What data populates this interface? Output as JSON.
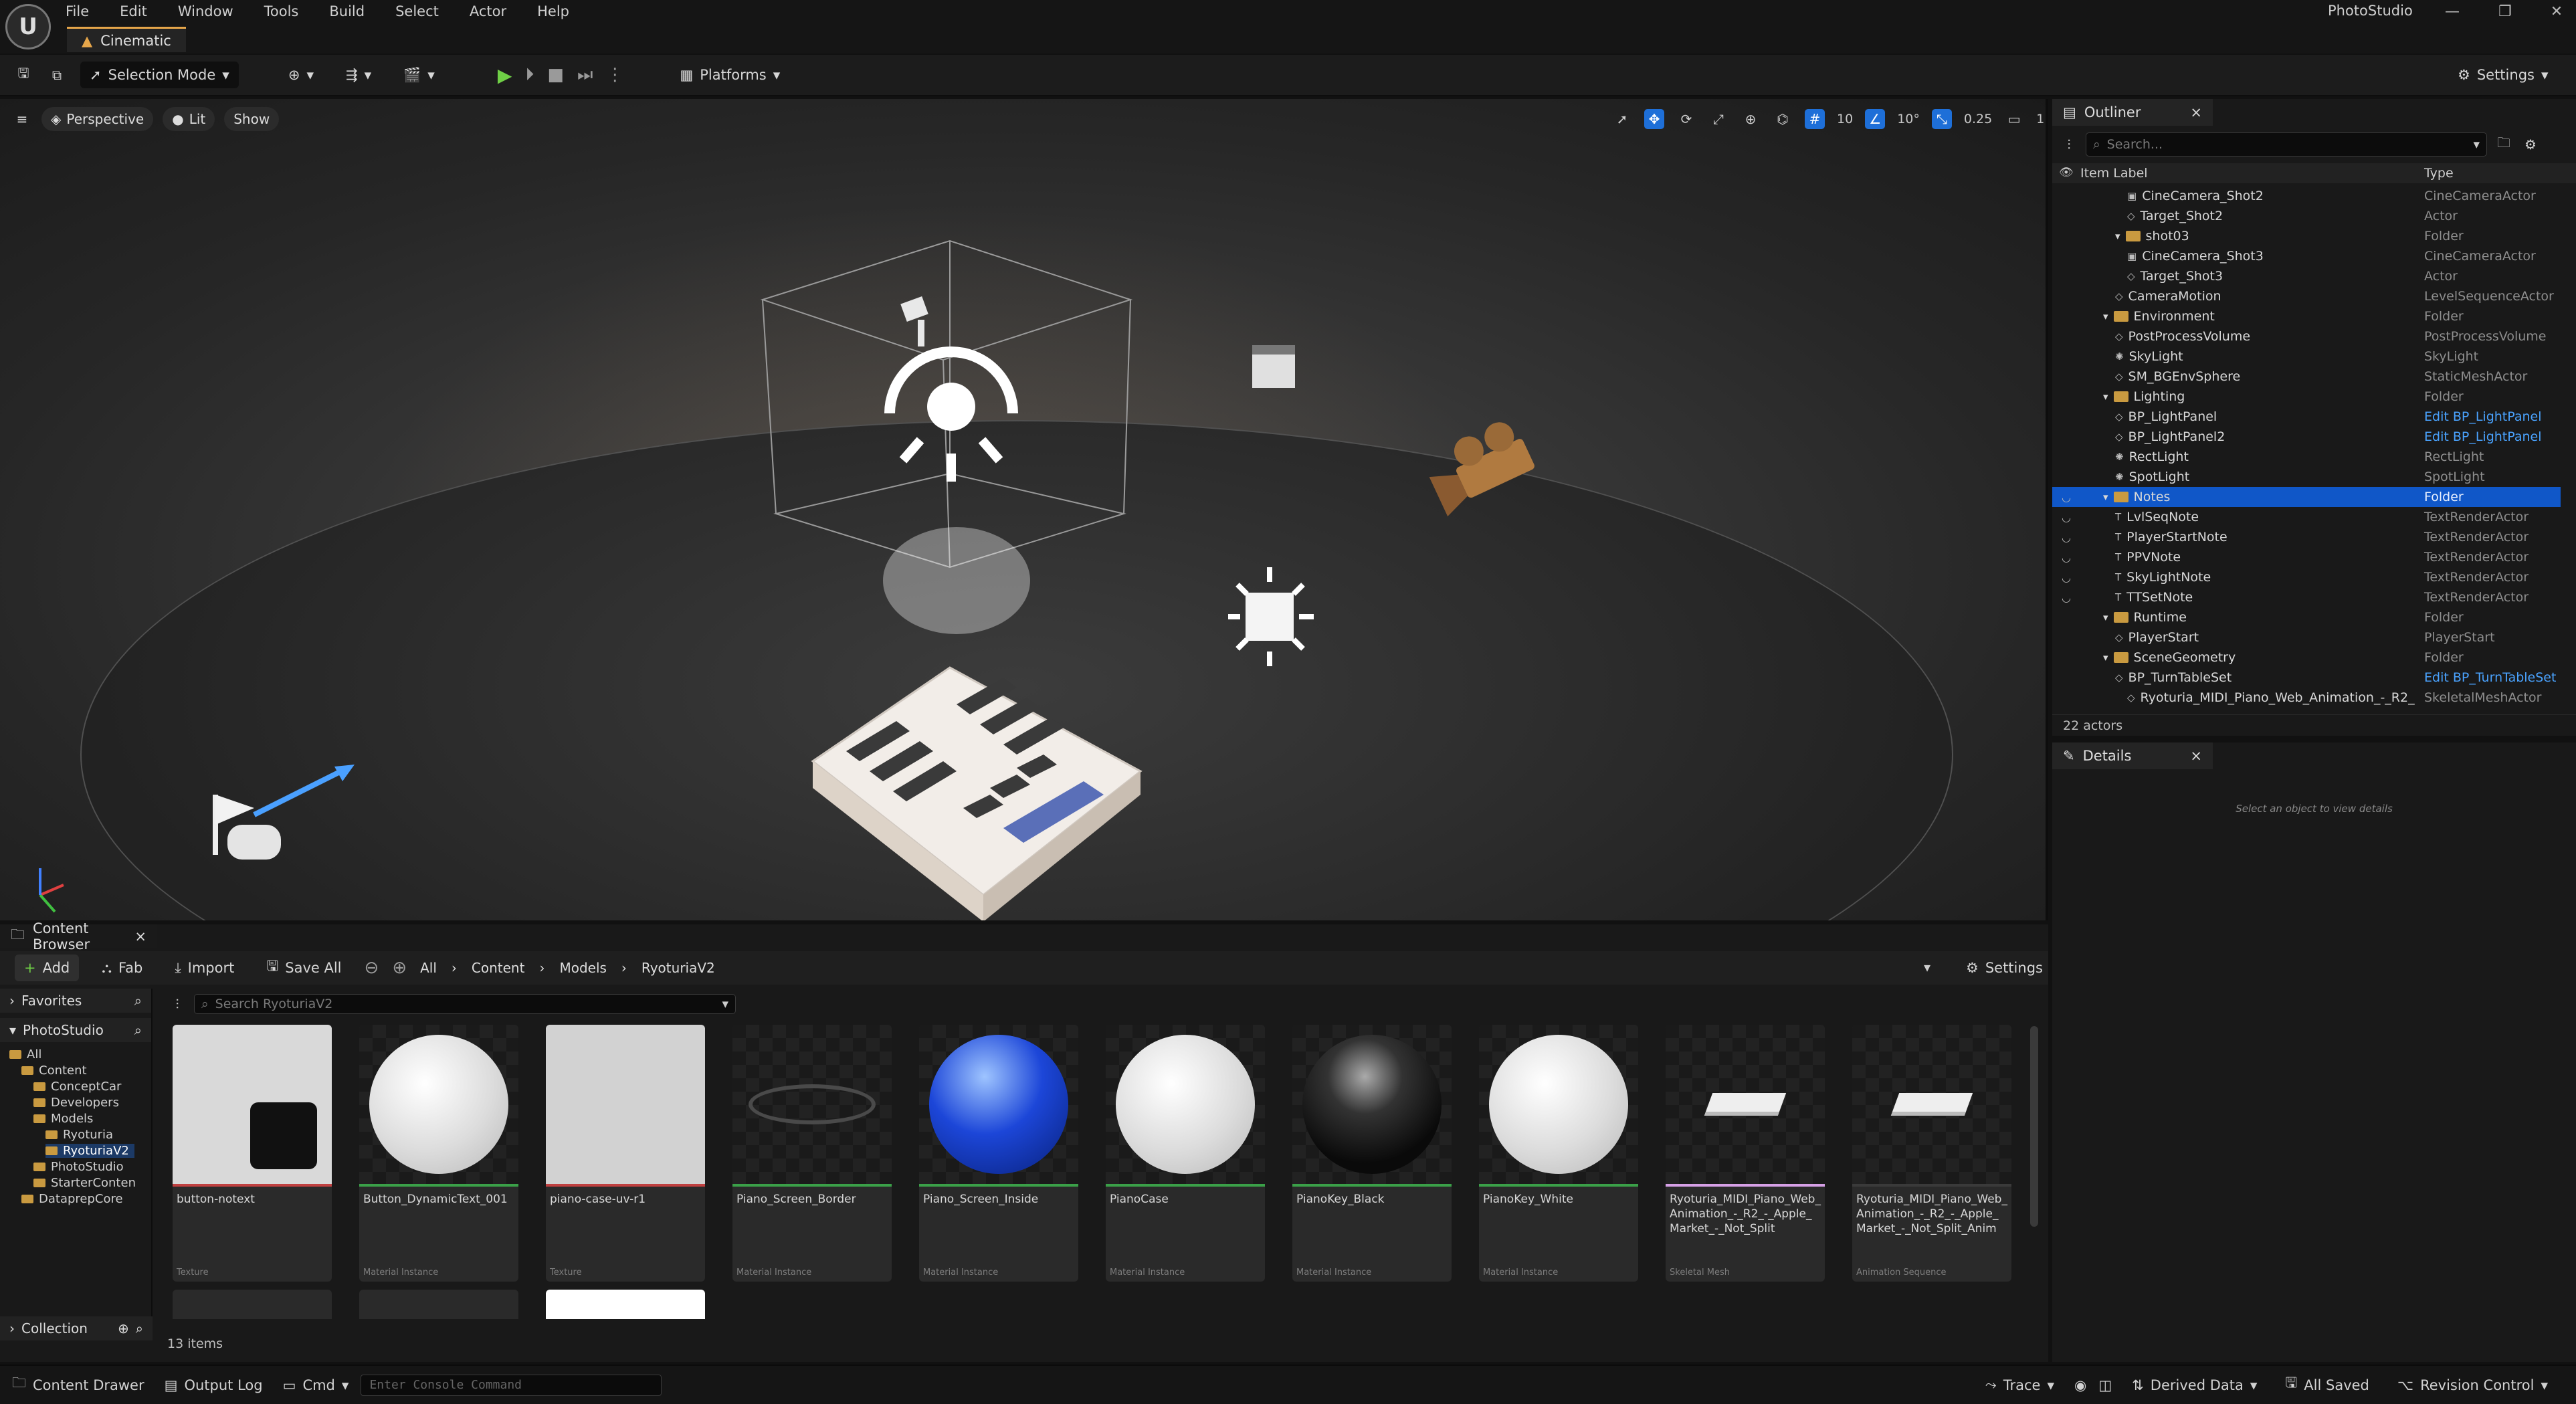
{
  "menubar": {
    "logo": "U",
    "menus": [
      "File",
      "Edit",
      "Window",
      "Tools",
      "Build",
      "Select",
      "Actor",
      "Help"
    ],
    "tab": "Cinematic",
    "app_title": "PhotoStudio",
    "win_controls": [
      "—",
      "❐",
      "✕"
    ]
  },
  "toolbar": {
    "selection_mode": "Selection Mode",
    "platforms": "Platforms",
    "settings": "Settings"
  },
  "viewport": {
    "perspective": "Perspective",
    "lit": "Lit",
    "show": "Show",
    "grid_snap": "10",
    "rot_snap": "10°",
    "scale_snap": "0.25",
    "camera_speed": "1"
  },
  "outliner": {
    "tab": "Outliner",
    "search_placeholder": "Search...",
    "col_label": "Item Label",
    "col_type": "Type",
    "rows": [
      {
        "label": "CineCamera_Shot2",
        "type": "CineCameraActor",
        "indent": 4,
        "kind": "camera"
      },
      {
        "label": "Target_Shot2",
        "type": "Actor",
        "indent": 4,
        "kind": "actor"
      },
      {
        "label": "shot03",
        "type": "Folder",
        "indent": 3,
        "kind": "folder"
      },
      {
        "label": "CineCamera_Shot3",
        "type": "CineCameraActor",
        "indent": 4,
        "kind": "camera"
      },
      {
        "label": "Target_Shot3",
        "type": "Actor",
        "indent": 4,
        "kind": "actor"
      },
      {
        "label": "CameraMotion",
        "type": "LevelSequenceActor",
        "indent": 3,
        "kind": "actor"
      },
      {
        "label": "Environment",
        "type": "Folder",
        "indent": 2,
        "kind": "folder"
      },
      {
        "label": "PostProcessVolume",
        "type": "PostProcessVolume",
        "indent": 3,
        "kind": "actor"
      },
      {
        "label": "SkyLight",
        "type": "SkyLight",
        "indent": 3,
        "kind": "light"
      },
      {
        "label": "SM_BGEnvSphere",
        "type": "StaticMeshActor",
        "indent": 3,
        "kind": "actor"
      },
      {
        "label": "Lighting",
        "type": "Folder",
        "indent": 2,
        "kind": "folder"
      },
      {
        "label": "BP_LightPanel",
        "type": "Edit BP_LightPanel",
        "indent": 3,
        "kind": "actor",
        "link": true
      },
      {
        "label": "BP_LightPanel2",
        "type": "Edit BP_LightPanel",
        "indent": 3,
        "kind": "actor",
        "link": true
      },
      {
        "label": "RectLight",
        "type": "RectLight",
        "indent": 3,
        "kind": "light"
      },
      {
        "label": "SpotLight",
        "type": "SpotLight",
        "indent": 3,
        "kind": "light"
      },
      {
        "label": "Notes",
        "type": "Folder",
        "indent": 2,
        "kind": "folder",
        "selected": true,
        "eye": true
      },
      {
        "label": "LvlSeqNote",
        "type": "TextRenderActor",
        "indent": 3,
        "kind": "text",
        "eye": true
      },
      {
        "label": "PlayerStartNote",
        "type": "TextRenderActor",
        "indent": 3,
        "kind": "text",
        "eye": true
      },
      {
        "label": "PPVNote",
        "type": "TextRenderActor",
        "indent": 3,
        "kind": "text",
        "eye": true
      },
      {
        "label": "SkyLightNote",
        "type": "TextRenderActor",
        "indent": 3,
        "kind": "text",
        "eye": true
      },
      {
        "label": "TTSetNote",
        "type": "TextRenderActor",
        "indent": 3,
        "kind": "text",
        "eye": true
      },
      {
        "label": "Runtime",
        "type": "Folder",
        "indent": 2,
        "kind": "folder"
      },
      {
        "label": "PlayerStart",
        "type": "PlayerStart",
        "indent": 3,
        "kind": "actor"
      },
      {
        "label": "SceneGeometry",
        "type": "Folder",
        "indent": 2,
        "kind": "folder"
      },
      {
        "label": "BP_TurnTableSet",
        "type": "Edit BP_TurnTableSet",
        "indent": 3,
        "kind": "actor",
        "link": true
      },
      {
        "label": "Ryoturia_MIDI_Piano_Web_Animation_-_R2_",
        "type": "SkeletalMeshActor",
        "indent": 4,
        "kind": "actor"
      }
    ],
    "actor_count": "22 actors"
  },
  "details": {
    "tab": "Details",
    "empty_text": "Select an object to view details"
  },
  "content_browser": {
    "tab": "Content Browser",
    "add": "Add",
    "fab": "Fab",
    "import": "Import",
    "save_all": "Save All",
    "breadcrumb": [
      "All",
      "Content",
      "Models",
      "RyoturiaV2"
    ],
    "settings": "Settings",
    "search_placeholder": "Search RyoturiaV2",
    "favorites": "Favorites",
    "project": "PhotoStudio",
    "collections": "Collection",
    "tree": [
      {
        "label": "All",
        "level": 0
      },
      {
        "label": "Content",
        "level": 1
      },
      {
        "label": "ConceptCar",
        "level": 2
      },
      {
        "label": "Developers",
        "level": 2
      },
      {
        "label": "Models",
        "level": 2
      },
      {
        "label": "Ryoturia",
        "level": 3
      },
      {
        "label": "RyoturiaV2",
        "level": 3,
        "selected": true
      },
      {
        "label": "PhotoStudio",
        "level": 2
      },
      {
        "label": "StarterConten",
        "level": 2
      },
      {
        "label": "DataprepCore",
        "level": 1
      }
    ],
    "assets": [
      {
        "name": "button-notext",
        "kind": "Texture",
        "bar": "#c04040",
        "thumb": "tex-btn"
      },
      {
        "name": "Button_DynamicText_001",
        "kind": "Material Instance",
        "bar": "#3aa048",
        "thumb": "white"
      },
      {
        "name": "piano-case-uv-r1",
        "kind": "Texture",
        "bar": "#c04040",
        "thumb": "tex-case"
      },
      {
        "name": "Piano_Screen_Border",
        "kind": "Material Instance",
        "bar": "#3aa048",
        "thumb": "ring"
      },
      {
        "name": "Piano_Screen_Inside",
        "kind": "Material Instance",
        "bar": "#3aa048",
        "thumb": "blue"
      },
      {
        "name": "PianoCase",
        "kind": "Material Instance",
        "bar": "#3aa048",
        "thumb": "white"
      },
      {
        "name": "PianoKey_Black",
        "kind": "Material Instance",
        "bar": "#3aa048",
        "thumb": "black"
      },
      {
        "name": "PianoKey_White",
        "kind": "Material Instance",
        "bar": "#3aa048",
        "thumb": "white"
      },
      {
        "name": "Ryoturia_MIDI_Piano_Web_Animation_-_R2_-_Apple_Market_-_Not_Split",
        "kind": "Skeletal Mesh",
        "bar": "#d6a0e6",
        "thumb": "piano"
      },
      {
        "name": "Ryoturia_MIDI_Piano_Web_Animation_-_R2_-_Apple_Market_-_Not_Split_Anim",
        "kind": "Animation Sequence",
        "bar": "#3a3a3a",
        "thumb": "piano"
      }
    ],
    "item_count": "13 items"
  },
  "statusbar": {
    "content_drawer": "Content Drawer",
    "output_log": "Output Log",
    "cmd": "Cmd",
    "console_placeholder": "Enter Console Command",
    "trace": "Trace",
    "derived_data": "Derived Data",
    "all_saved": "All Saved",
    "revision_control": "Revision Control"
  }
}
